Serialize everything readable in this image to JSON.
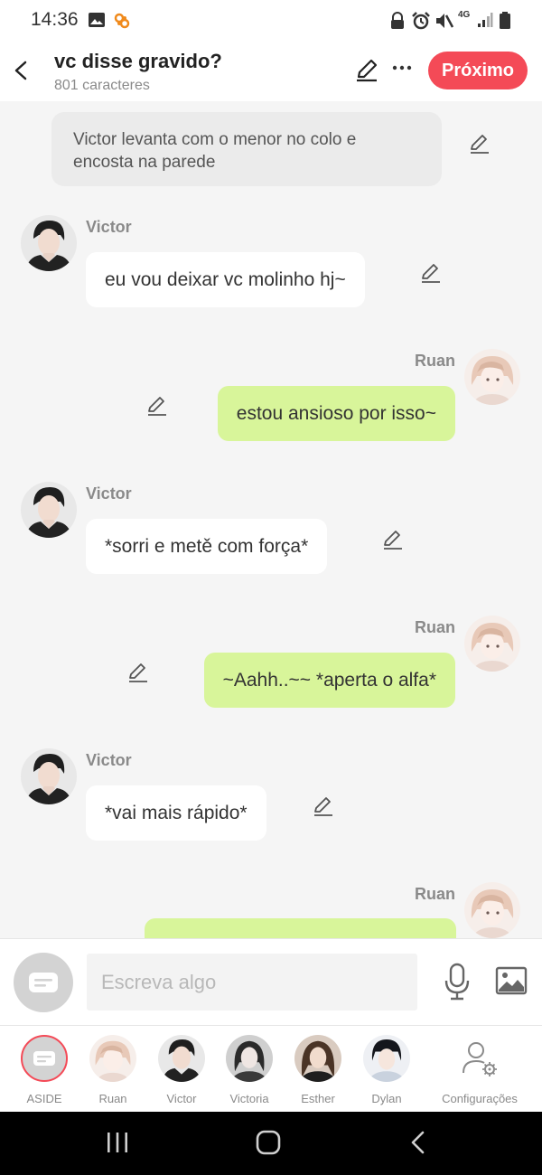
{
  "status_bar": {
    "time": "14:36",
    "network": "4G"
  },
  "header": {
    "title": "vc disse gravido?",
    "subtitle": "801 caracteres",
    "next_label": "Próximo"
  },
  "chat": {
    "narration": "Victor levanta com o menor no colo e encosta na parede",
    "messages": [
      {
        "side": "left",
        "name": "Victor",
        "text": "eu vou deixar vc molinho hj~"
      },
      {
        "side": "right",
        "name": "Ruan",
        "text": "estou ansioso por isso~"
      },
      {
        "side": "left",
        "name": "Victor",
        "text": "*sorri e metě com força*"
      },
      {
        "side": "right",
        "name": "Ruan",
        "text": "~Aahh..~~ *aperta o alfa*"
      },
      {
        "side": "left",
        "name": "Victor",
        "text": "*vai mais rápido*"
      },
      {
        "side": "right",
        "name": "Ruan",
        "text": ""
      }
    ]
  },
  "input": {
    "placeholder": "Escreva algo"
  },
  "characters": [
    {
      "label": "ASIDE"
    },
    {
      "label": "Ruan"
    },
    {
      "label": "Victor"
    },
    {
      "label": "Victoria"
    },
    {
      "label": "Esther"
    },
    {
      "label": "Dylan"
    },
    {
      "label": "Configurações"
    }
  ],
  "colors": {
    "accent": "#f44a57",
    "bubble_right": "#d8f59a",
    "bubble_left": "#ffffff",
    "narration_bg": "#ebebeb"
  }
}
